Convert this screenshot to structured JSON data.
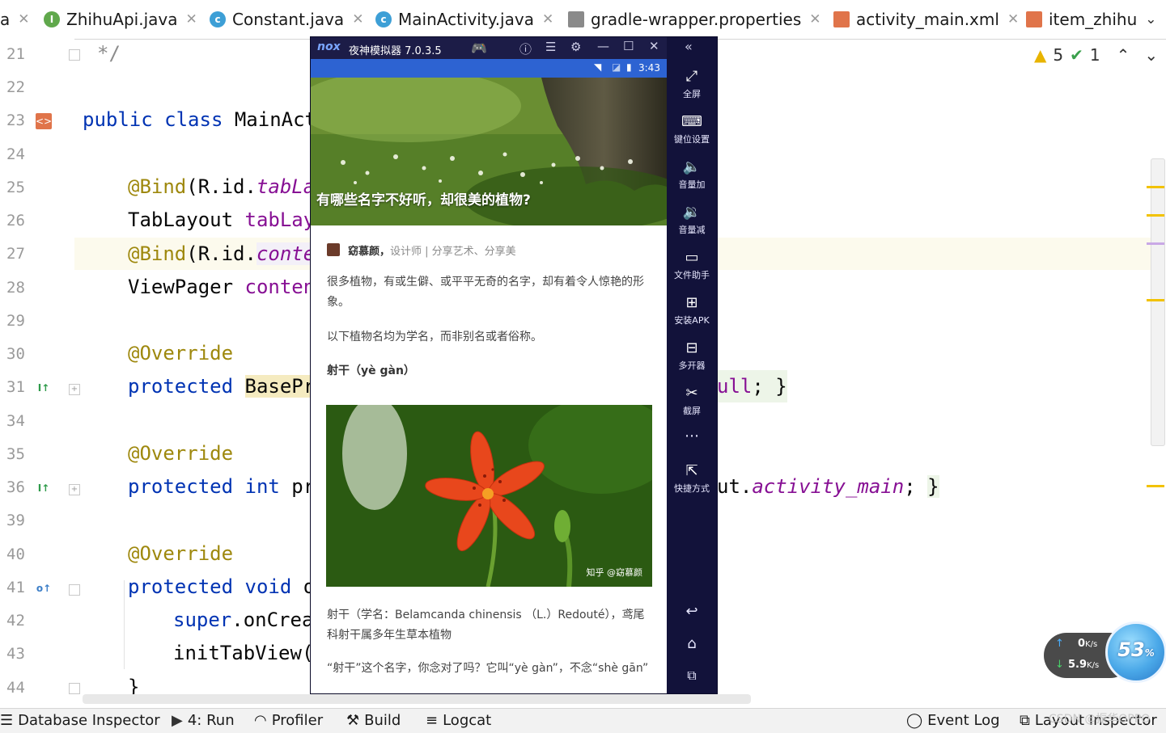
{
  "tabs": [
    {
      "label": "a",
      "icon": "",
      "active": false
    },
    {
      "label": "ZhihuApi.java",
      "icon": "I",
      "active": false
    },
    {
      "label": "Constant.java",
      "icon": "c",
      "active": false
    },
    {
      "label": "MainActivity.java",
      "icon": "c",
      "active": true
    },
    {
      "label": "gradle-wrapper.properties",
      "icon": "gradle",
      "active": false
    },
    {
      "label": "activity_main.xml",
      "icon": "xml",
      "active": false
    },
    {
      "label": "item_zhihu",
      "icon": "xml",
      "active": false
    }
  ],
  "editor": {
    "line_numbers": [
      "21",
      "22",
      "23",
      "24",
      "25",
      "26",
      "27",
      "28",
      "29",
      "30",
      "31",
      "34",
      "35",
      "36",
      "39",
      "40",
      "41",
      "42",
      "43",
      "44"
    ],
    "current_line": "27",
    "lines": [
      "*/",
      "",
      "public class MainAct",
      "",
      "@Bind(R.id.tabLa",
      "TabLayout tabLay",
      "@Bind(R.id.conte",
      "ViewPager conten",
      "",
      "@Override",
      "protected BasePr",
      "",
      "@Override",
      "protected int pr",
      "",
      "@Override",
      "protected void o",
      "super.onCrea",
      "initTabView(",
      "}"
    ],
    "right_fragments": {
      "line31": "ull; }",
      "line36": "ut.activity_main; }"
    },
    "warnings": "5",
    "checks": "1"
  },
  "emulator": {
    "title": "夜神模拟器 7.0.3.5",
    "brand": "nox",
    "time": "3:43",
    "hero_title": "有哪些名字不好听，却很美的植物?",
    "author_name": "窈慕颜，",
    "author_desc": "设计师 | 分享艺术、分享美",
    "para1": "很多植物，有或生僻、或平平无奇的名字，却有着令人惊艳的形象。",
    "para2": "以下植物名均为学名，而非别名或者俗称。",
    "heading": "射干（yè gàn）",
    "watermark": "知乎 @窈慕颜",
    "para3": "射干（学名：Belamcanda chinensis （L.）Redouté），鸢尾科射干属多年生草本植物",
    "para4": "“射干”这个名字，你念对了吗？它叫“yè gàn”，不念“shè gān”",
    "side_items": [
      "全屏",
      "键位设置",
      "音量加",
      "音量减",
      "文件助手",
      "安装APK",
      "多开器",
      "截屏",
      "快捷方式"
    ]
  },
  "bottom_tools": [
    {
      "label": "Database Inspector"
    },
    {
      "label": "4: Run"
    },
    {
      "label": "Profiler"
    },
    {
      "label": "Build"
    },
    {
      "label": "Logcat"
    },
    {
      "label": "Event Log"
    },
    {
      "label": "Layout Inspector"
    }
  ],
  "speed_widget": {
    "up": "0",
    "up_unit": "K/s",
    "down": "5.9",
    "down_unit": "K/s",
    "percent": "53",
    "percent_sign": "%"
  },
  "watermark_csdn": "CSDN @振华OPPO",
  "colors": {
    "keyword": "#0033b3",
    "annotation": "#9e880d",
    "field": "#871094",
    "accent": "#4083c9",
    "emulator_bg": "#12123a",
    "statusbar": "#2d63d2"
  }
}
